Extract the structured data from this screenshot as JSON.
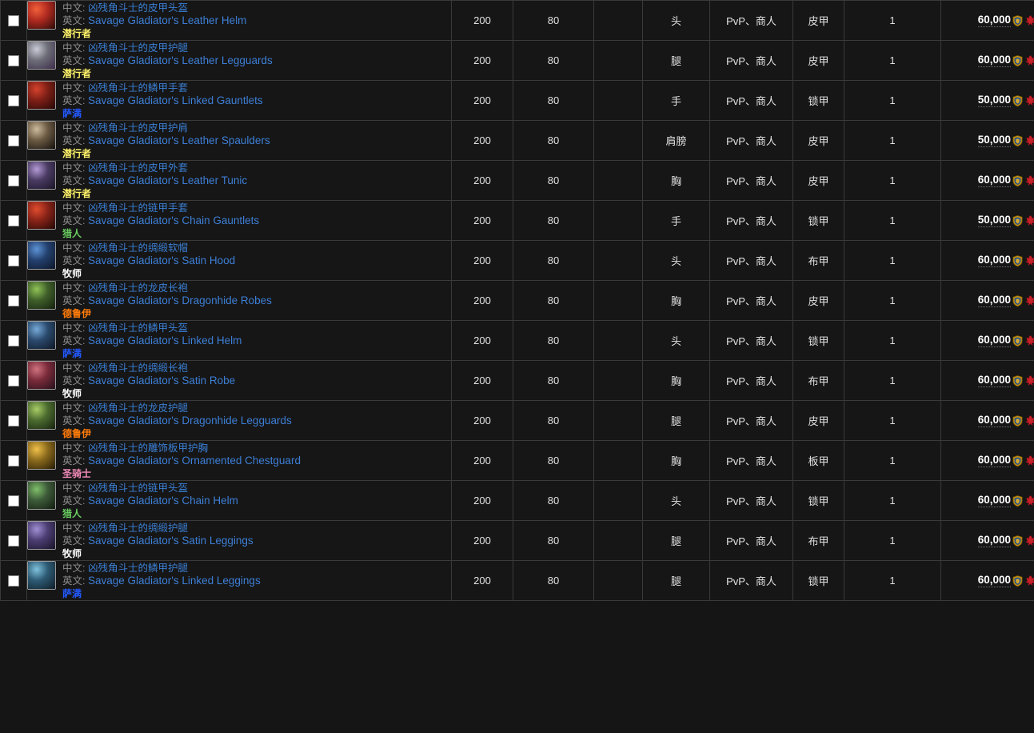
{
  "page": {
    "labels": {
      "cn": "中文:",
      "en": "英文:"
    },
    "currency": {
      "alliance_icon": "alliance-shield-icon",
      "horde_icon": "horde-emblem-icon"
    },
    "class_colors": {
      "潜行者": "#fff468",
      "萨满": "#2359ff",
      "猎人": "#69cc60",
      "牧师": "#ffffff",
      "德鲁伊": "#ff7c0a",
      "圣骑士": "#f48cba"
    },
    "icon_colors": {
      "leather-helm": [
        "#b02a20",
        "#f2603a",
        "#2a0b08"
      ],
      "leather-legguards": [
        "#6d6e78",
        "#c9cbd6",
        "#3c2b4a"
      ],
      "linked-gauntlets": [
        "#7e1f16",
        "#d4422c",
        "#240806"
      ],
      "leather-spaulders": [
        "#6b5a43",
        "#cdbb9c",
        "#120f0c"
      ],
      "leather-tunic": [
        "#4a3b63",
        "#b49ad6",
        "#1a1426"
      ],
      "chain-gauntlets": [
        "#8a2318",
        "#e04c2e",
        "#200806"
      ],
      "satin-hood": [
        "#23406e",
        "#5d93d6",
        "#0c1628"
      ],
      "dragonhide-robes": [
        "#3f5f2a",
        "#8fc356",
        "#15200e"
      ],
      "linked-helm": [
        "#2b4a6e",
        "#76aad8",
        "#0d1724"
      ],
      "satin-robe": [
        "#7a2b3a",
        "#d0727f",
        "#24101a"
      ],
      "dragonhide-legguards": [
        "#4b6b2f",
        "#a8cc66",
        "#16220e"
      ],
      "ornamented-chestguard": [
        "#8a6a1c",
        "#f0c04a",
        "#251a06"
      ],
      "chain-helm": [
        "#3c5a38",
        "#7fbf6a",
        "#121c10"
      ],
      "satin-leggings": [
        "#4b3d72",
        "#9f8fd4",
        "#181327"
      ],
      "linked-leggings": [
        "#2d5a74",
        "#7fc2dc",
        "#0e1d26"
      ]
    }
  },
  "rows": [
    {
      "checked": false,
      "icon": "leather-helm",
      "cn_name": "凶残角斗士的皮甲头盔",
      "en_name": "Savage Gladiator's Leather Helm",
      "class": "潜行者",
      "ilvl": "200",
      "req_level": "80",
      "blank": "",
      "slot": "头",
      "source": "PvP、商人",
      "armor": "皮甲",
      "qty": "1",
      "cost": "60,000"
    },
    {
      "checked": false,
      "icon": "leather-legguards",
      "cn_name": "凶残角斗士的皮甲护腿",
      "en_name": "Savage Gladiator's Leather Legguards",
      "class": "潜行者",
      "ilvl": "200",
      "req_level": "80",
      "blank": "",
      "slot": "腿",
      "source": "PvP、商人",
      "armor": "皮甲",
      "qty": "1",
      "cost": "60,000"
    },
    {
      "checked": false,
      "icon": "linked-gauntlets",
      "cn_name": "凶残角斗士的鳞甲手套",
      "en_name": "Savage Gladiator's Linked Gauntlets",
      "class": "萨满",
      "ilvl": "200",
      "req_level": "80",
      "blank": "",
      "slot": "手",
      "source": "PvP、商人",
      "armor": "锁甲",
      "qty": "1",
      "cost": "50,000"
    },
    {
      "checked": false,
      "icon": "leather-spaulders",
      "cn_name": "凶残角斗士的皮甲护肩",
      "en_name": "Savage Gladiator's Leather Spaulders",
      "class": "潜行者",
      "ilvl": "200",
      "req_level": "80",
      "blank": "",
      "slot": "肩膀",
      "source": "PvP、商人",
      "armor": "皮甲",
      "qty": "1",
      "cost": "50,000"
    },
    {
      "checked": false,
      "icon": "leather-tunic",
      "cn_name": "凶残角斗士的皮甲外套",
      "en_name": "Savage Gladiator's Leather Tunic",
      "class": "潜行者",
      "ilvl": "200",
      "req_level": "80",
      "blank": "",
      "slot": "胸",
      "source": "PvP、商人",
      "armor": "皮甲",
      "qty": "1",
      "cost": "60,000"
    },
    {
      "checked": false,
      "icon": "chain-gauntlets",
      "cn_name": "凶残角斗士的链甲手套",
      "en_name": "Savage Gladiator's Chain Gauntlets",
      "class": "猎人",
      "ilvl": "200",
      "req_level": "80",
      "blank": "",
      "slot": "手",
      "source": "PvP、商人",
      "armor": "锁甲",
      "qty": "1",
      "cost": "50,000"
    },
    {
      "checked": false,
      "icon": "satin-hood",
      "cn_name": "凶残角斗士的绸缎软帽",
      "en_name": "Savage Gladiator's Satin Hood",
      "class": "牧师",
      "ilvl": "200",
      "req_level": "80",
      "blank": "",
      "slot": "头",
      "source": "PvP、商人",
      "armor": "布甲",
      "qty": "1",
      "cost": "60,000"
    },
    {
      "checked": false,
      "icon": "dragonhide-robes",
      "cn_name": "凶残角斗士的龙皮长袍",
      "en_name": "Savage Gladiator's Dragonhide Robes",
      "class": "德鲁伊",
      "ilvl": "200",
      "req_level": "80",
      "blank": "",
      "slot": "胸",
      "source": "PvP、商人",
      "armor": "皮甲",
      "qty": "1",
      "cost": "60,000"
    },
    {
      "checked": false,
      "icon": "linked-helm",
      "cn_name": "凶残角斗士的鳞甲头盔",
      "en_name": "Savage Gladiator's Linked Helm",
      "class": "萨满",
      "ilvl": "200",
      "req_level": "80",
      "blank": "",
      "slot": "头",
      "source": "PvP、商人",
      "armor": "锁甲",
      "qty": "1",
      "cost": "60,000"
    },
    {
      "checked": false,
      "icon": "satin-robe",
      "cn_name": "凶残角斗士的绸缎长袍",
      "en_name": "Savage Gladiator's Satin Robe",
      "class": "牧师",
      "ilvl": "200",
      "req_level": "80",
      "blank": "",
      "slot": "胸",
      "source": "PvP、商人",
      "armor": "布甲",
      "qty": "1",
      "cost": "60,000"
    },
    {
      "checked": false,
      "icon": "dragonhide-legguards",
      "cn_name": "凶残角斗士的龙皮护腿",
      "en_name": "Savage Gladiator's Dragonhide Legguards",
      "class": "德鲁伊",
      "ilvl": "200",
      "req_level": "80",
      "blank": "",
      "slot": "腿",
      "source": "PvP、商人",
      "armor": "皮甲",
      "qty": "1",
      "cost": "60,000"
    },
    {
      "checked": false,
      "icon": "ornamented-chestguard",
      "cn_name": "凶残角斗士的雕饰板甲护胸",
      "en_name": "Savage Gladiator's Ornamented Chestguard",
      "class": "圣骑士",
      "ilvl": "200",
      "req_level": "80",
      "blank": "",
      "slot": "胸",
      "source": "PvP、商人",
      "armor": "板甲",
      "qty": "1",
      "cost": "60,000"
    },
    {
      "checked": false,
      "icon": "chain-helm",
      "cn_name": "凶残角斗士的链甲头盔",
      "en_name": "Savage Gladiator's Chain Helm",
      "class": "猎人",
      "ilvl": "200",
      "req_level": "80",
      "blank": "",
      "slot": "头",
      "source": "PvP、商人",
      "armor": "锁甲",
      "qty": "1",
      "cost": "60,000"
    },
    {
      "checked": false,
      "icon": "satin-leggings",
      "cn_name": "凶残角斗士的绸缎护腿",
      "en_name": "Savage Gladiator's Satin Leggings",
      "class": "牧师",
      "ilvl": "200",
      "req_level": "80",
      "blank": "",
      "slot": "腿",
      "source": "PvP、商人",
      "armor": "布甲",
      "qty": "1",
      "cost": "60,000"
    },
    {
      "checked": false,
      "icon": "linked-leggings",
      "cn_name": "凶残角斗士的鳞甲护腿",
      "en_name": "Savage Gladiator's Linked Leggings",
      "class": "萨满",
      "ilvl": "200",
      "req_level": "80",
      "blank": "",
      "slot": "腿",
      "source": "PvP、商人",
      "armor": "锁甲",
      "qty": "1",
      "cost": "60,000"
    }
  ]
}
